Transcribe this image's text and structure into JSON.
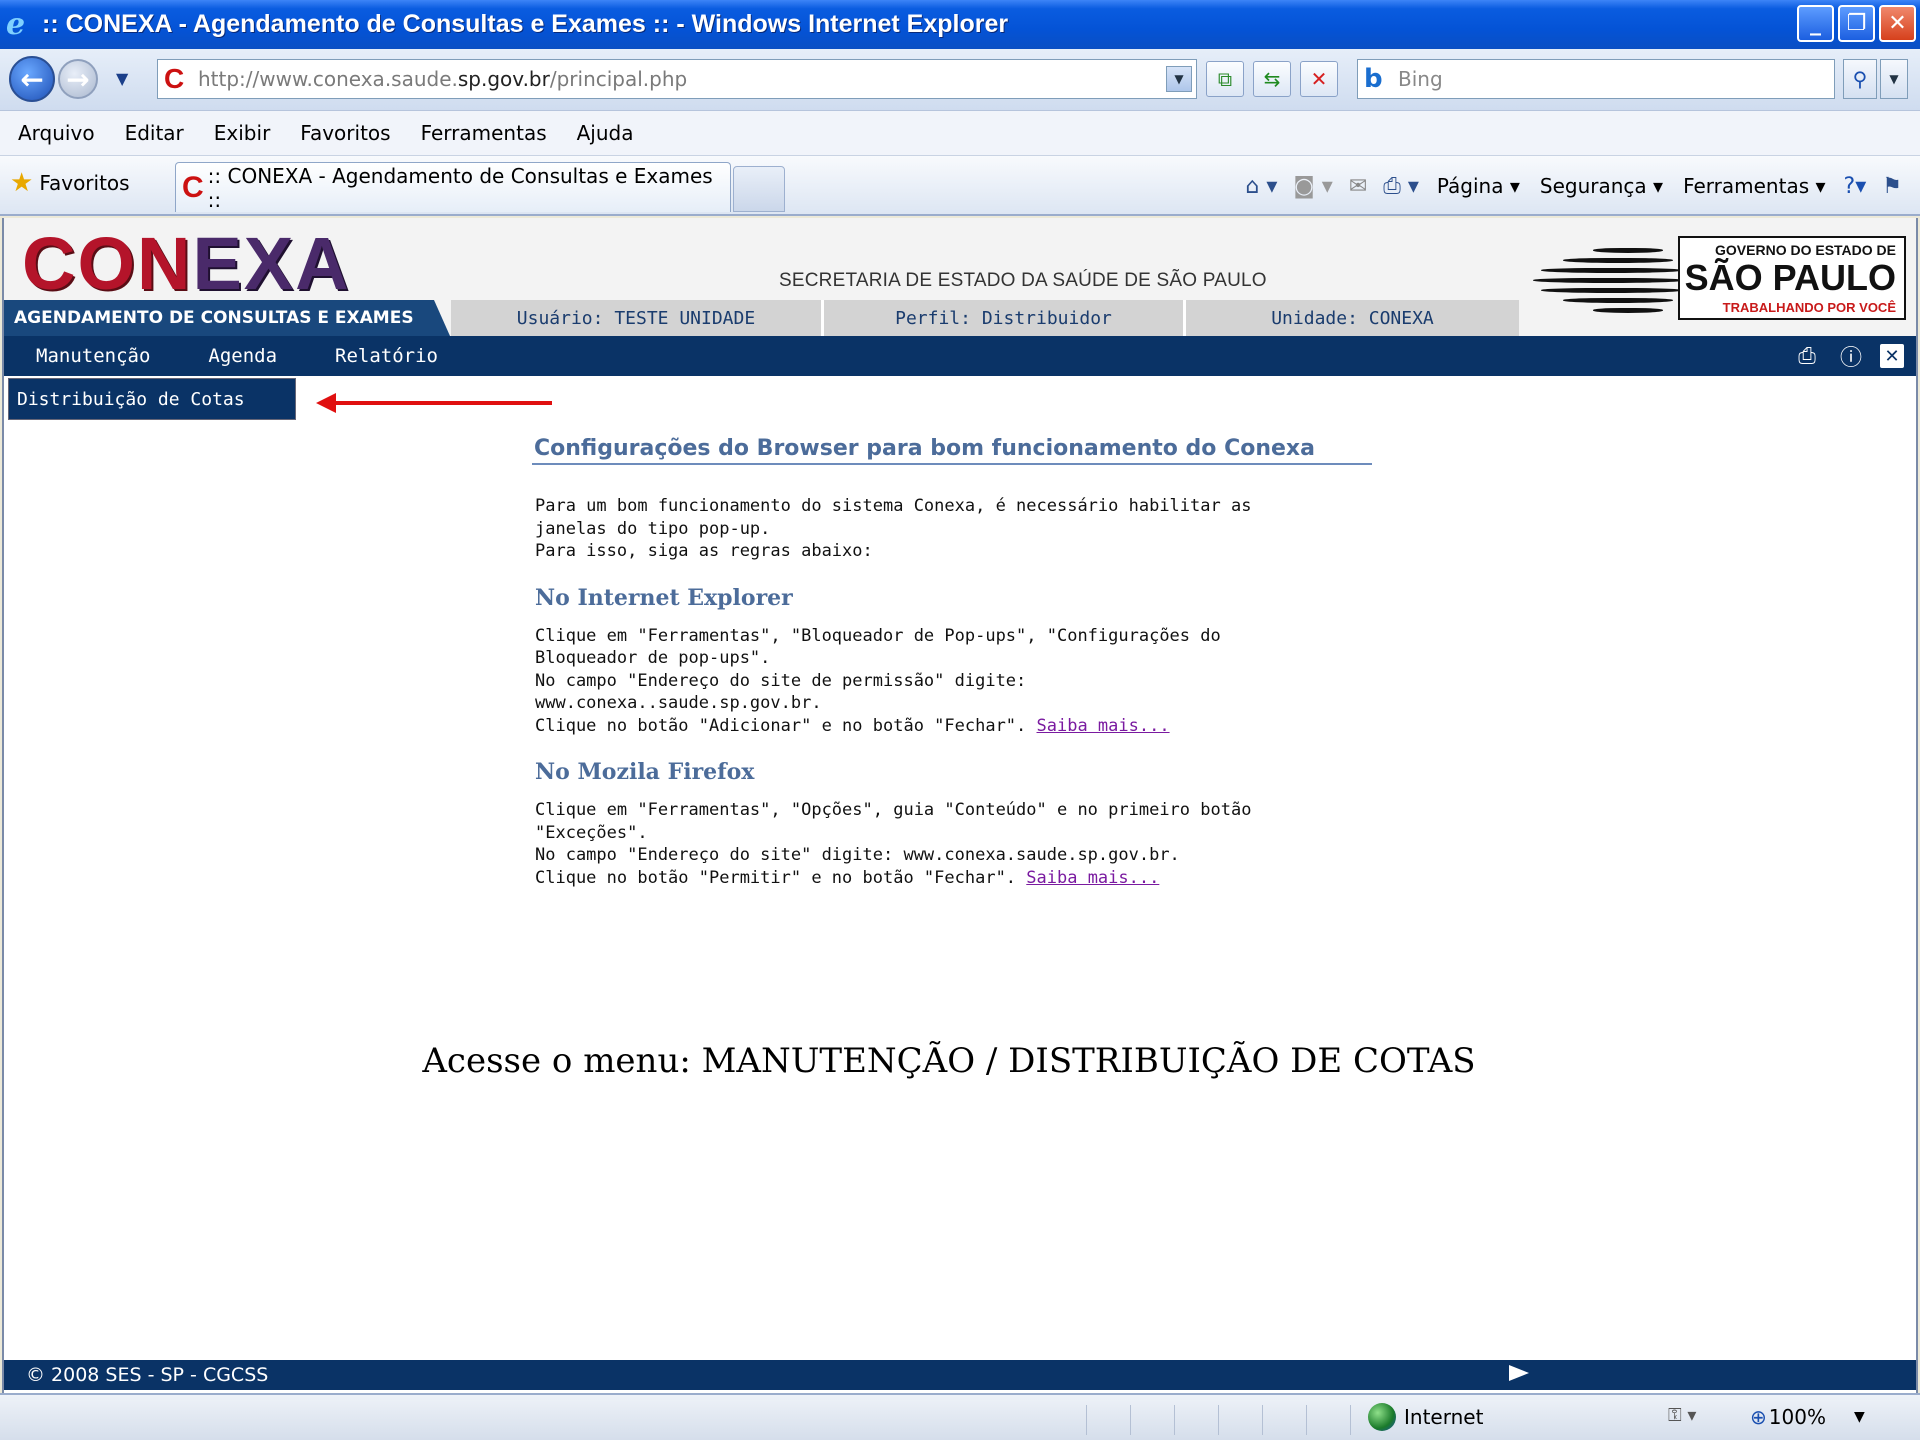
{
  "window": {
    "title": ":: CONEXA - Agendamento de Consultas e Exames :: - Windows Internet Explorer",
    "min_glyph": "_",
    "max_glyph": "❐",
    "close_glyph": "✕"
  },
  "address": {
    "url_prefix": "http://www.conexa.saude.",
    "url_domain": "sp.gov.br",
    "url_path": "/principal.php"
  },
  "search": {
    "placeholder": "Bing"
  },
  "menubar": [
    "Arquivo",
    "Editar",
    "Exibir",
    "Favoritos",
    "Ferramentas",
    "Ajuda"
  ],
  "favorites": {
    "label": "Favoritos",
    "tab_title": ":: CONEXA - Agendamento de Consultas e Exames ::"
  },
  "commandbar": {
    "pagina": "Página ▾",
    "seguranca": "Segurança ▾",
    "ferramentas": "Ferramentas ▾"
  },
  "header": {
    "logo_a": "CON",
    "logo_b": "EXA",
    "secretaria": "SECRETARIA DE ESTADO DA SAÚDE DE SÃO PAULO",
    "gov_line1": "GOVERNO DO ESTADO DE",
    "gov_line2": "SÃO PAULO",
    "gov_line3": "TRABALHANDO POR VOCÊ",
    "agendamento": "AGENDAMENTO DE CONSULTAS E EXAMES",
    "usuario": "Usuário: TESTE UNIDADE",
    "perfil": "Perfil: Distribuidor",
    "unidade": "Unidade: CONEXA"
  },
  "navmenu": [
    "Manutenção",
    "Agenda",
    "Relatório"
  ],
  "submenu": "Distribuição de Cotas",
  "content": {
    "title": "Configurações do Browser para bom funcionamento do Conexa",
    "intro": [
      "Para um bom funcionamento do sistema Conexa, é necessário habilitar as",
      "janelas do tipo pop-up.",
      "Para isso, siga as regras abaixo:"
    ],
    "ie_title": "No Internet Explorer",
    "ie_lines": [
      "Clique em \"Ferramentas\", \"Bloqueador de Pop-ups\", \"Configurações do",
      "Bloqueador de pop-ups\".",
      "No campo \"Endereço do site de permissão\" digite:",
      "www.conexa..saude.sp.gov.br."
    ],
    "ie_last": "Clique no botão \"Adicionar\" e no botão \"Fechar\". ",
    "ff_title": "No Mozila Firefox",
    "ff_lines": [
      "Clique em \"Ferramentas\", \"Opções\", guia \"Conteúdo\" e no primeiro botão",
      "\"Exceções\".",
      "No campo \"Endereço do site\" digite: www.conexa.saude.sp.gov.br."
    ],
    "ff_last": "Clique no botão \"Permitir\" e no botão \"Fechar\". ",
    "saiba_mais": "Saiba mais..."
  },
  "caption": "Acesse o menu: MANUTENÇÃO / DISTRIBUIÇÃO DE COTAS",
  "footer": {
    "copyright": "© 2008 SES - SP - CGCSS"
  },
  "statusbar": {
    "zone": "Internet",
    "zoom": "100%"
  },
  "colors": {
    "navy": "#0a3366",
    "accent_red": "#e01010",
    "heading_blue": "#4c6c9a"
  }
}
